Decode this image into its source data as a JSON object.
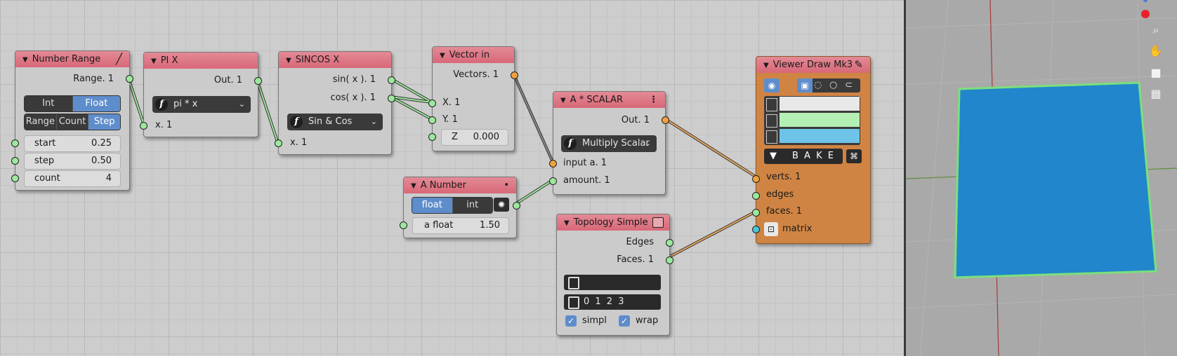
{
  "nodes": {
    "number_range": {
      "title": "Number Range",
      "output": "Range. 1",
      "mode_int": "Int",
      "mode_float": "Float",
      "range_tab": "Range",
      "count_tab": "Count",
      "step_tab": "Step",
      "start_label": "start",
      "start_value": "0.25",
      "step_label": "step",
      "step_value": "0.50",
      "count_label": "count",
      "count_value": "4"
    },
    "pi_x": {
      "title": "PI X",
      "output": "Out. 1",
      "function": "pi * x",
      "input": "x. 1"
    },
    "sincos_x": {
      "title": "SINCOS X",
      "output_sin": "sin( x ). 1",
      "output_cos": "cos( x ). 1",
      "function": "Sin & Cos",
      "input": "x. 1"
    },
    "vector_in": {
      "title": "Vector in",
      "output": "Vectors. 1",
      "input_x": "X. 1",
      "input_y": "Y. 1",
      "z_label": "Z",
      "z_value": "0.000"
    },
    "a_number": {
      "title": "A Number",
      "mode_float": "float",
      "mode_int": "int",
      "field_label": "a float",
      "field_value": "1.50"
    },
    "a_scalar": {
      "title": "A * SCALAR",
      "output": "Out. 1",
      "function": "Multiply Scalar",
      "input_a": "input a. 1",
      "input_amount": "amount. 1"
    },
    "topology_simple": {
      "title": "Topology Simple",
      "output_edges": "Edges",
      "output_faces": "Faces. 1",
      "edges_field": "",
      "faces_field": "0 1 2 3",
      "simpl_label": "simpl",
      "wrap_label": "wrap"
    },
    "viewer_draw": {
      "title": "Viewer Draw Mk3",
      "bake_label": "B A K E",
      "input_verts": "verts. 1",
      "input_edges": "edges",
      "input_faces": "faces. 1",
      "input_matrix": "matrix"
    }
  },
  "colors": {
    "node_header": "#d86878",
    "viewer_body": "#d08443",
    "toggle_blue": "#5e8dcc",
    "vert_color": "#e8e8e8",
    "edge_color": "#b4f0b4",
    "face_color": "#6ec4e8",
    "mesh_face": "#2186cc",
    "mesh_edge": "#7be07b"
  },
  "icons": [
    "function-icon",
    "chevron-down-icon",
    "eye-icon",
    "cube-icon",
    "zoom-icon",
    "hand-icon",
    "camera-icon",
    "grid-icon",
    "settings-icon",
    "pencil-icon",
    "bake-icon",
    "checkbox-icon"
  ]
}
